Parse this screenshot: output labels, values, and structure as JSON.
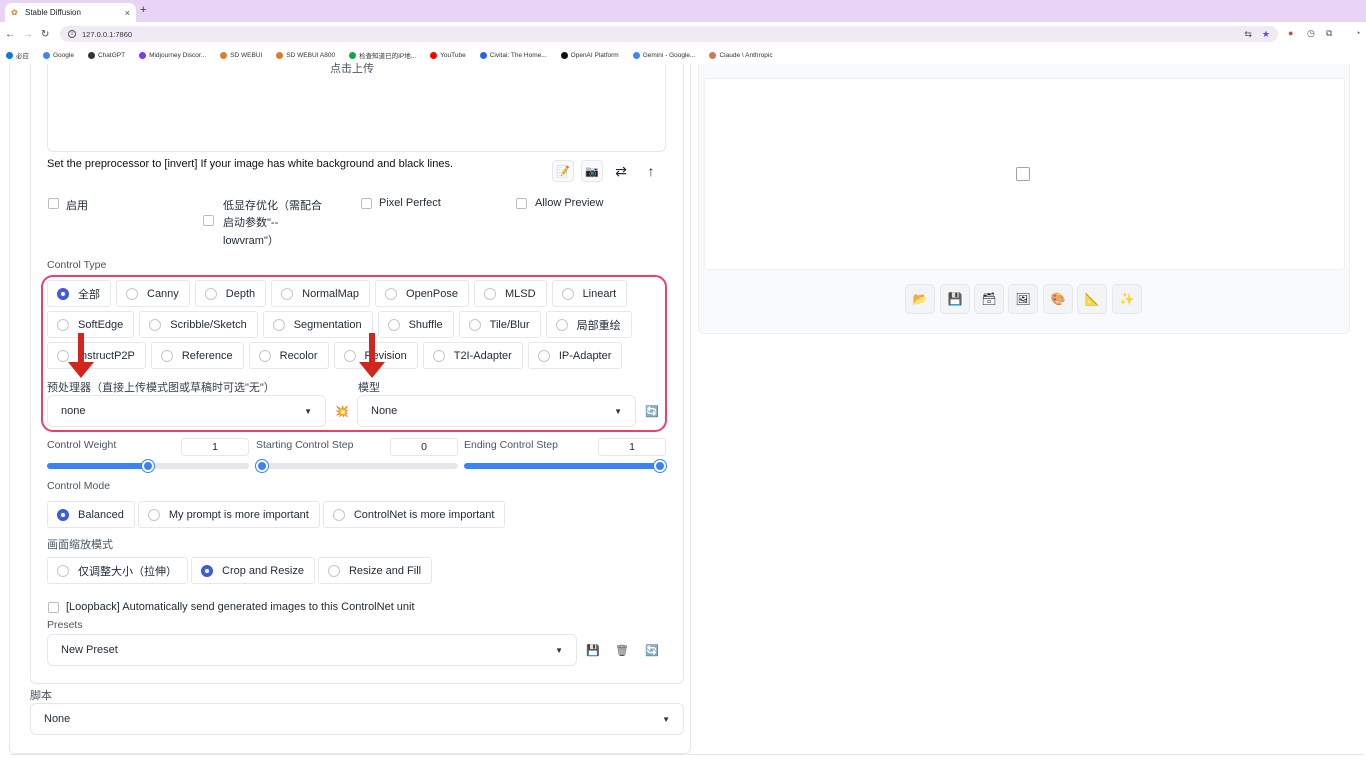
{
  "browser": {
    "tab_title": "Stable Diffusion",
    "new_tab_icon": "+",
    "close_icon": "×",
    "url": "127.0.0.1:7860",
    "bookmarks": [
      {
        "label": "必应",
        "color": "#0a7cd6"
      },
      {
        "label": "Google",
        "color": "#4285f4"
      },
      {
        "label": "ChatGPT",
        "color": "#333333"
      },
      {
        "label": "Midjourney Discor...",
        "color": "#7c3aed"
      },
      {
        "label": "SD WEBUI",
        "color": "#e07b2b"
      },
      {
        "label": "SD WEBUI A800",
        "color": "#e07b2b"
      },
      {
        "label": "检查知道已的IP地...",
        "color": "#16a34a"
      },
      {
        "label": "YouTube",
        "color": "#ff0000"
      },
      {
        "label": "Civitai: The Home...",
        "color": "#2563eb"
      },
      {
        "label": "OpenAI Platform",
        "color": "#111111"
      },
      {
        "label": "Gemini - Google...",
        "color": "#4285f4"
      },
      {
        "label": "Claude \\ Anthropic",
        "color": "#cc785c"
      }
    ]
  },
  "controlnet": {
    "upload_text": "点击上传",
    "hint": "Set the preprocessor to [invert] If your image has white background and black lines.",
    "enable_label": "启用",
    "lowvram_label_1": "低显存优化（需配合",
    "lowvram_label_2": "启动参数\"--",
    "lowvram_label_3": "lowvram\"）",
    "pixel_perfect_label": "Pixel Perfect",
    "allow_preview_label": "Allow Preview",
    "control_type_label": "Control Type",
    "control_types_row1": [
      "全部",
      "Canny",
      "Depth",
      "NormalMap",
      "OpenPose",
      "MLSD",
      "Lineart"
    ],
    "control_types_row2": [
      "SoftEdge",
      "Scribble/Sketch",
      "Segmentation",
      "Shuffle",
      "Tile/Blur",
      "局部重绘"
    ],
    "control_types_row3": [
      "InstructP2P",
      "Reference",
      "Recolor",
      "Revision",
      "T2I-Adapter",
      "IP-Adapter"
    ],
    "selected_control_type": "全部",
    "preprocessor_label": "预处理器（直接上传模式图或草稿时可选\"无\"）",
    "preprocessor_value": "none",
    "model_label": "模型",
    "model_value": "None",
    "control_weight_label": "Control Weight",
    "control_weight_value": "1",
    "control_weight_fraction": 0.5,
    "starting_step_label": "Starting Control Step",
    "starting_step_value": "0",
    "ending_step_label": "Ending Control Step",
    "ending_step_value": "1",
    "control_mode_label": "Control Mode",
    "control_modes": [
      "Balanced",
      "My prompt is more important",
      "ControlNet is more important"
    ],
    "selected_control_mode": "Balanced",
    "resize_mode_label": "画面缩放模式",
    "resize_modes": [
      "仅调整大小（拉伸）",
      "Crop and Resize",
      "Resize and Fill"
    ],
    "selected_resize_mode": "Crop and Resize",
    "loopback_label": "[Loopback] Automatically send generated images to this ControlNet unit",
    "presets_label": "Presets",
    "preset_value": "New Preset"
  },
  "script": {
    "label": "脚本",
    "value": "None"
  },
  "colors": {
    "accent": "#3b5bdb",
    "highlight_border": "#e8416d",
    "annotation_arrow": "#d0261e"
  }
}
